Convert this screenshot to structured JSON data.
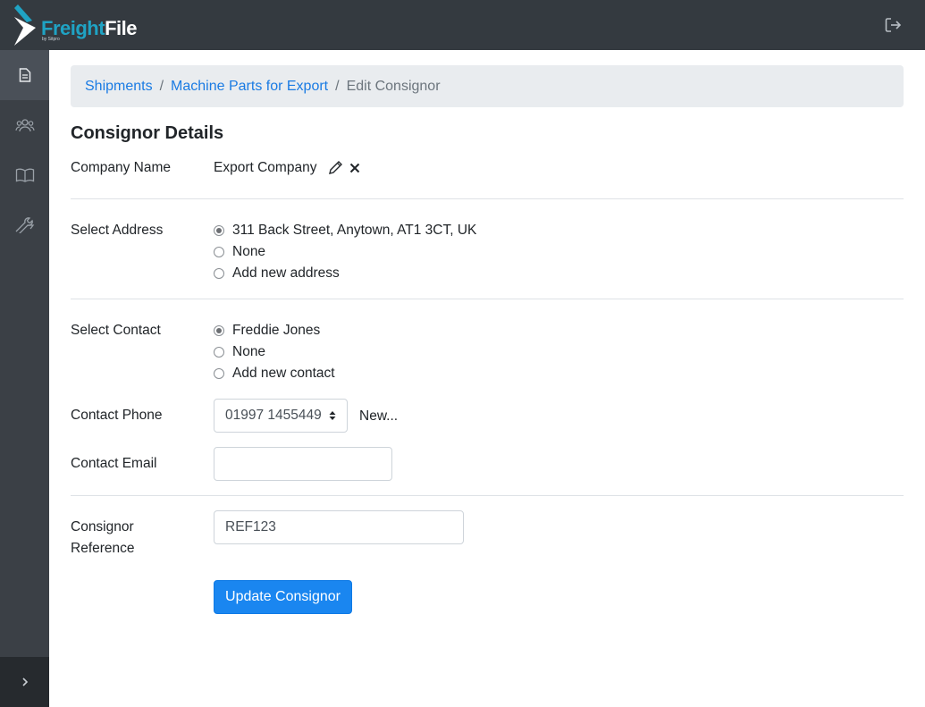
{
  "brand": {
    "name_part1": "Freight",
    "name_part2": "File",
    "tagline": "by Sitpro"
  },
  "topbar": {
    "logout_icon": "sign-out-icon"
  },
  "sidebar": {
    "items": [
      {
        "icon": "document-icon",
        "active": true
      },
      {
        "icon": "users-icon"
      },
      {
        "icon": "book-icon"
      },
      {
        "icon": "tools-icon"
      }
    ],
    "expand_icon": "chevron-right-icon"
  },
  "breadcrumb": {
    "items": [
      {
        "label": "Shipments"
      },
      {
        "label": "Machine Parts for Export"
      }
    ],
    "current": "Edit Consignor",
    "separator": "/"
  },
  "form": {
    "title": "Consignor Details",
    "company": {
      "label": "Company Name",
      "value": "Export Company"
    },
    "address": {
      "label": "Select Address",
      "options": [
        {
          "label": "311 Back Street, Anytown, AT1 3CT, UK",
          "checked": true
        },
        {
          "label": "None",
          "checked": false
        },
        {
          "label": "Add new address",
          "checked": false
        }
      ]
    },
    "contact": {
      "label": "Select Contact",
      "options": [
        {
          "label": "Freddie Jones",
          "checked": true
        },
        {
          "label": "None",
          "checked": false
        },
        {
          "label": "Add new contact",
          "checked": false
        }
      ]
    },
    "phone": {
      "label": "Contact Phone",
      "value": "01997 1455449",
      "new_label": "New..."
    },
    "email": {
      "label": "Contact Email",
      "value": ""
    },
    "reference": {
      "label_line1": "Consignor",
      "label_line2": "Reference",
      "value": "REF123"
    },
    "submit_label": "Update Consignor"
  },
  "colors": {
    "accent": "#1a86f0",
    "link": "#1a7be3",
    "topbar": "#343a40",
    "sidebar": "#3b4046",
    "brand_teal": "#1fa3c4"
  }
}
